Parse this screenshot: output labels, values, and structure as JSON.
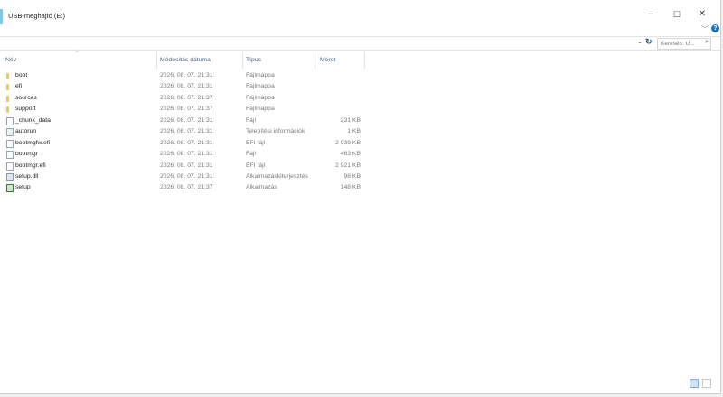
{
  "window": {
    "title": "USB-meghajtó (E:)",
    "minimize_glyph": "–",
    "maximize_glyph": "☐",
    "close_glyph": "✕",
    "expand_glyph": "﹀",
    "help_glyph": "?"
  },
  "colors": {
    "accent": "#7ec8e3",
    "help": "#1e73be",
    "folder": "#f2c94c"
  },
  "address_bar": {
    "dropdown_glyph": "⌄",
    "refresh_glyph": "↻"
  },
  "search": {
    "placeholder": "Keresés: U...",
    "icon": "search-icon",
    "icon_glyph": "⌕"
  },
  "columns": {
    "sort_arrow": "^",
    "name": "Név",
    "date": "Módosítás dátuma",
    "type": "Típus",
    "size": "Méret"
  },
  "files": [
    {
      "name": "boot",
      "date": "2026. 08. 07. 21:31",
      "type": "Fájlmappa",
      "size": "",
      "icon": "folder-icon"
    },
    {
      "name": "efi",
      "date": "2026. 08. 07. 21:31",
      "type": "Fájlmappa",
      "size": "",
      "icon": "folder-icon"
    },
    {
      "name": "sources",
      "date": "2026. 08. 07. 21:37",
      "type": "Fájlmappa",
      "size": "",
      "icon": "folder-icon"
    },
    {
      "name": "support",
      "date": "2026. 08. 07. 21:37",
      "type": "Fájlmappa",
      "size": "",
      "icon": "folder-icon"
    },
    {
      "name": "_chunk_data",
      "date": "2026. 08. 07. 21:31",
      "type": "Fájl",
      "size": "231 KB",
      "icon": "file-icon"
    },
    {
      "name": "autorun",
      "date": "2026. 08. 07. 21:31",
      "type": "Telepítési információk",
      "size": "1 KB",
      "icon": "setup-info-icon"
    },
    {
      "name": "bootmgfw.efi",
      "date": "2026. 08. 07. 21:31",
      "type": "EFI fájl",
      "size": "2 939 KB",
      "icon": "file-icon"
    },
    {
      "name": "bootmgr",
      "date": "2026. 08. 07. 21:31",
      "type": "Fájl",
      "size": "463 KB",
      "icon": "file-icon"
    },
    {
      "name": "bootmgr.efi",
      "date": "2026. 08. 07. 21:31",
      "type": "EFI fájl",
      "size": "2 921 KB",
      "icon": "file-icon"
    },
    {
      "name": "setup.dll",
      "date": "2026. 08. 07. 21:31",
      "type": "Alkalmazáskiterjesztés",
      "size": "98 KB",
      "icon": "dll-icon"
    },
    {
      "name": "setup",
      "date": "2026. 08. 07. 21:37",
      "type": "Alkalmazás",
      "size": "148 KB",
      "icon": "application-icon"
    }
  ],
  "view_buttons": [
    "details-view-icon",
    "large-icons-view-icon"
  ]
}
